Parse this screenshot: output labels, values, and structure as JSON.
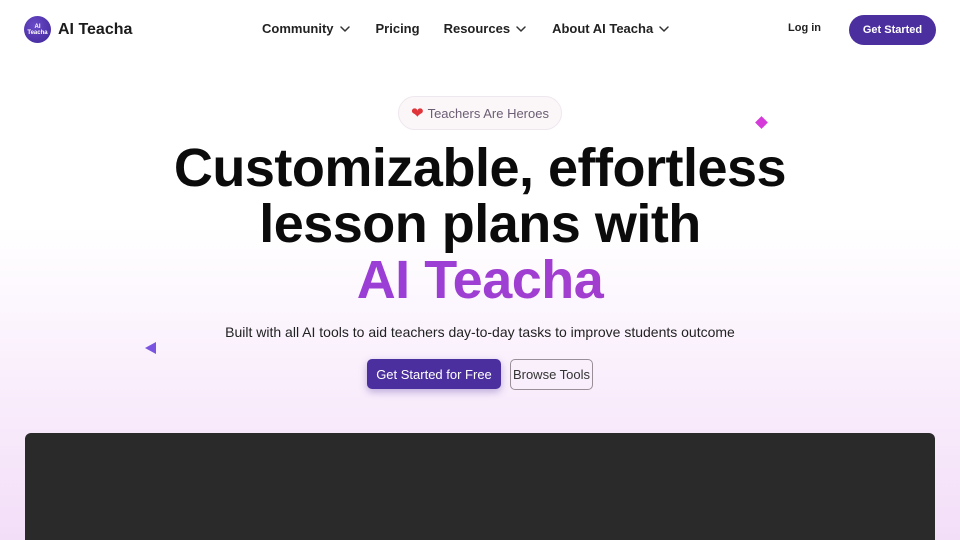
{
  "nav": {
    "logo_badge_text": "AI Teacha",
    "logo_text": "AI Teacha",
    "links": [
      {
        "label": "Community",
        "has_dropdown": true
      },
      {
        "label": "Pricing",
        "has_dropdown": false
      },
      {
        "label": "Resources",
        "has_dropdown": true
      },
      {
        "label": "About AI Teacha",
        "has_dropdown": true
      }
    ],
    "login_label": "Log in",
    "get_started_label": "Get Started"
  },
  "hero": {
    "pill_icon": "heart-icon",
    "pill_text": "Teachers Are Heroes",
    "headline_line1": "Customizable, effortless",
    "headline_line2": "lesson plans with",
    "headline_accent": "AI Teacha",
    "subtitle": "Built with all AI tools to aid teachers day-to-day tasks to improve students outcome",
    "cta_primary": "Get Started for Free",
    "cta_secondary": "Browse Tools"
  },
  "colors": {
    "brand": "#4b2f9e",
    "accent_gradient_start": "#8b3fe0",
    "accent_gradient_end": "#a23ed0",
    "diamond": "#d43bd8",
    "triangle": "#7a54e0",
    "video_panel": "#2a2a2a"
  }
}
